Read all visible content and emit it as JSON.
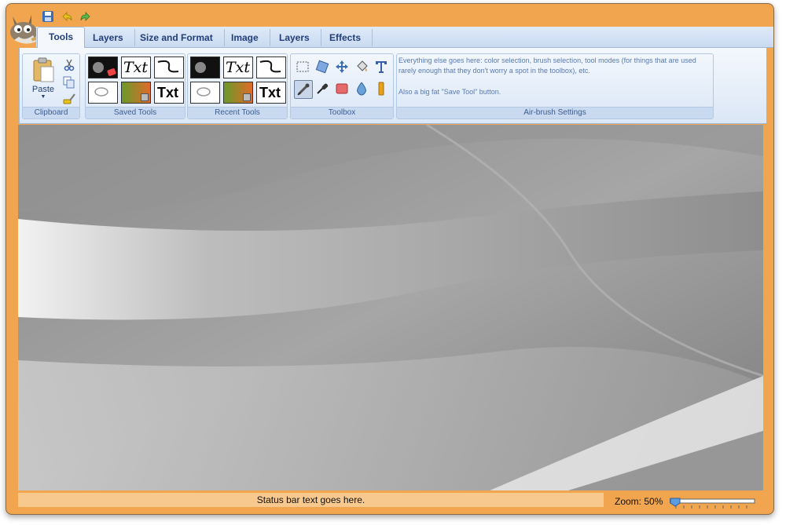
{
  "tabs": [
    {
      "label": "Tools",
      "active": true
    },
    {
      "label": "Layers",
      "active": false
    },
    {
      "label": "Size and Format",
      "active": false
    },
    {
      "label": "Image",
      "active": false
    },
    {
      "label": "Layers",
      "active": false
    },
    {
      "label": "Effects",
      "active": false
    }
  ],
  "clipboard": {
    "paste_label": "Paste",
    "group_label": "Clipboard"
  },
  "saved_tools": {
    "label": "Saved Tools"
  },
  "recent_tools": {
    "label": "Recent Tools"
  },
  "toolbox": {
    "label": "Toolbox"
  },
  "airbrush": {
    "label": "Air-brush Settings",
    "text1": "Everything else goes here: color selection, brush selection, tool modes (for things that are used rarely enough that they don't worry a spot in the toolbox), etc.",
    "text2": "Also a big fat \"Save Tool\" button."
  },
  "status": {
    "text": "Status bar text goes here."
  },
  "zoom": {
    "label": "Zoom: 50%",
    "value_percent": 50
  },
  "icons": [
    "save-icon",
    "undo-icon",
    "redo-icon",
    "paste-icon",
    "cut-icon",
    "copy-icon",
    "format-painter-icon",
    "rect-select-icon",
    "transform-icon",
    "move-icon",
    "bucket-fill-icon",
    "text-icon",
    "airbrush-icon",
    "color-picker-icon",
    "eraser-icon",
    "blur-icon",
    "smudge-icon"
  ],
  "colors": {
    "frame": "#f0a54e",
    "ribbon": "#dbe7f6",
    "tab_text": "#223e78",
    "status": "#f7c98f"
  },
  "tile_text": {
    "txt": "Txt",
    "script": "Txt"
  }
}
